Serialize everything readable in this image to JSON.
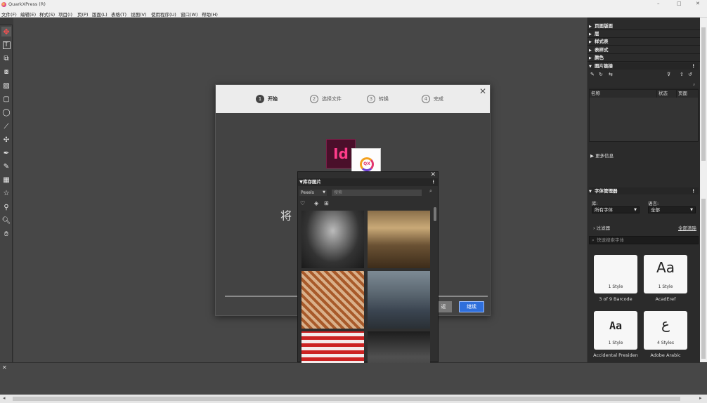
{
  "window": {
    "title": "QuarkXPress (R)",
    "controls": [
      "–",
      "□",
      "✕"
    ]
  },
  "menu": [
    "文件(F)",
    "编辑(E)",
    "样式(S)",
    "项目(I)",
    "页(P)",
    "版面(L)",
    "表格(T)",
    "视图(V)",
    "使用程序(U)",
    "窗口(W)",
    "帮助(H)"
  ],
  "tools": [
    "move-tool",
    "text-tool",
    "text-link-tool",
    "unlink-tool",
    "picture-tool",
    "rectangle-tool",
    "ellipse-tool",
    "line-tool",
    "pan-content-tool",
    "pen-tool",
    "pencil-tool",
    "table-tool",
    "star-tool",
    "eyedropper-tool",
    "zoom-tool",
    "hand-tool"
  ],
  "right_panel": {
    "sections": [
      "页面版面",
      "层",
      "样式表",
      "表样式",
      "颜色",
      "图片链接"
    ],
    "image_link": {
      "columns": [
        "名称",
        "状态",
        "页面"
      ],
      "more_info": "更多信息"
    },
    "font_manager": {
      "title": "字体管理器",
      "library_label": "库:",
      "library_value": "所有字体",
      "language_label": "语言:",
      "language_value": "全部",
      "filter_label": "过滤器",
      "clear_all": "全部清除",
      "search_placeholder": "快速搜索字体",
      "fonts": [
        {
          "preview": "",
          "styles": "1 Style",
          "name": "3 of 9 Barcode"
        },
        {
          "preview": "Aa",
          "styles": "1 Style",
          "name": "AcadEref"
        },
        {
          "preview": "Aa",
          "styles": "1 Style",
          "name": "Accidental Presiden"
        },
        {
          "preview": "ع",
          "styles": "4 Styles",
          "name": "Adobe Arabic"
        }
      ]
    }
  },
  "dialog": {
    "steps": [
      {
        "num": "1",
        "label": "开始"
      },
      {
        "num": "2",
        "label": "选择文件"
      },
      {
        "num": "3",
        "label": "转换"
      },
      {
        "num": "4",
        "label": "完成"
      }
    ],
    "id_logo": "Id",
    "qx_logo": "QX",
    "headline": "将",
    "back_label": "返",
    "next_label": "继续",
    "close": "✕"
  },
  "stock_panel": {
    "title": "库存图片",
    "source": "Pexels",
    "search_placeholder": "搜索",
    "close": "✕"
  }
}
